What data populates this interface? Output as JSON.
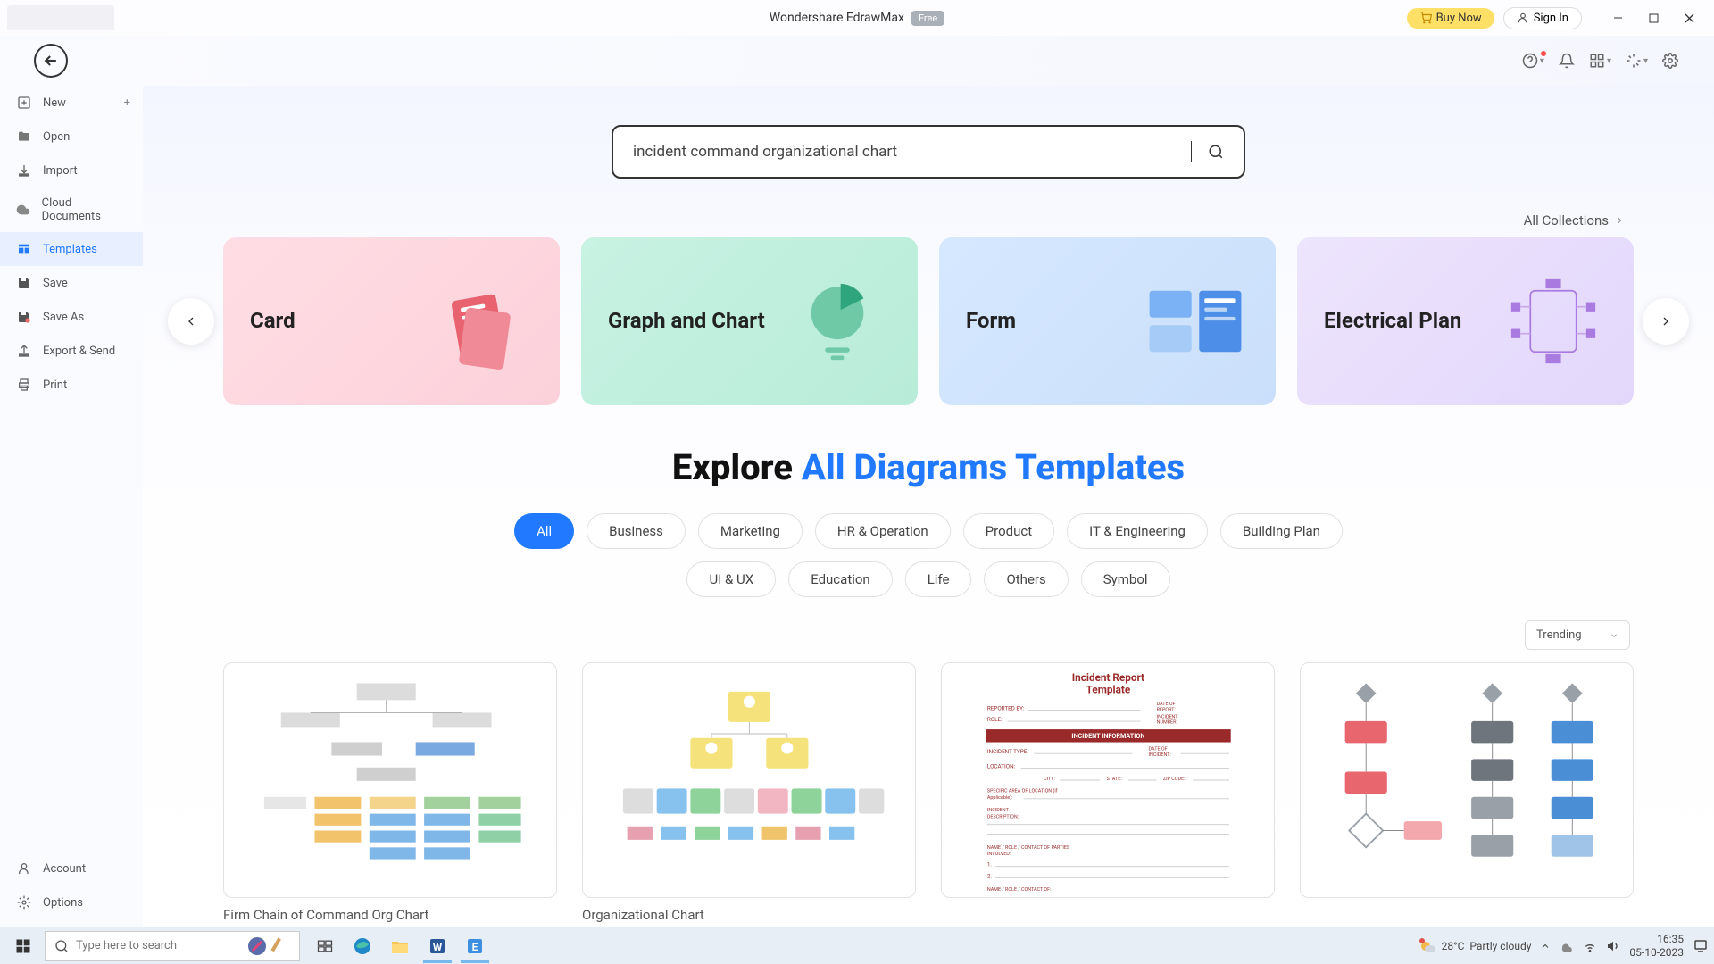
{
  "titlebar": {
    "app_name": "Wondershare EdrawMax",
    "badge": "Free",
    "buy_now": "Buy Now",
    "sign_in": "Sign In"
  },
  "sidebar": {
    "items": [
      {
        "label": "New",
        "icon": "plus-square"
      },
      {
        "label": "Open",
        "icon": "folder"
      },
      {
        "label": "Import",
        "icon": "import"
      },
      {
        "label": "Cloud Documents",
        "icon": "cloud"
      },
      {
        "label": "Templates",
        "icon": "templates"
      },
      {
        "label": "Save",
        "icon": "save"
      },
      {
        "label": "Save As",
        "icon": "save-as"
      },
      {
        "label": "Export & Send",
        "icon": "export"
      },
      {
        "label": "Print",
        "icon": "print"
      }
    ],
    "bottom": [
      {
        "label": "Account",
        "icon": "user"
      },
      {
        "label": "Options",
        "icon": "gear"
      }
    ]
  },
  "search": {
    "value": "incident command organizational chart"
  },
  "all_collections": "All Collections",
  "categories": [
    {
      "label": "Card",
      "theme": "pink"
    },
    {
      "label": "Graph and Chart",
      "theme": "green"
    },
    {
      "label": "Form",
      "theme": "blue"
    },
    {
      "label": "Electrical Plan",
      "theme": "purple"
    }
  ],
  "explore": {
    "prefix": "Explore ",
    "highlight": "All Diagrams Templates"
  },
  "chips_row1": [
    "All",
    "Business",
    "Marketing",
    "HR & Operation",
    "Product",
    "IT & Engineering",
    "Building Plan"
  ],
  "chips_row2": [
    "UI & UX",
    "Education",
    "Life",
    "Others",
    "Symbol"
  ],
  "active_chip": "All",
  "sort": "Trending",
  "templates": [
    {
      "title": "Firm Chain of Command Org Chart"
    },
    {
      "title": "Organizational Chart"
    },
    {
      "title": ""
    },
    {
      "title": ""
    }
  ],
  "incident_thumb": {
    "title": "Incident Report Template",
    "section": "INCIDENT INFORMATION",
    "fields_left": [
      "REPORTED BY:",
      "ROLE:",
      "INCIDENT TYPE:",
      "LOCATION:",
      "INCIDENT DESCRIPTION:",
      "NAME / ROLE / CONTACT OF PARTIES INVOLVED:",
      "1.",
      "2.",
      "NAME / ROLE / CONTACT OF:"
    ],
    "fields_right": [
      "DATE OF REPORT:",
      "INCIDENT NUMBER:",
      "DATE OF INCIDENT:",
      "CITY:",
      "STATE:",
      "ZIP CODE:",
      "SPECIFIC AREA OF LOCATION (if Applicable):"
    ]
  },
  "taskbar": {
    "search_placeholder": "Type here to search",
    "weather_temp": "28°C",
    "weather_text": "Partly cloudy",
    "time": "16:35",
    "date": "05-10-2023"
  }
}
